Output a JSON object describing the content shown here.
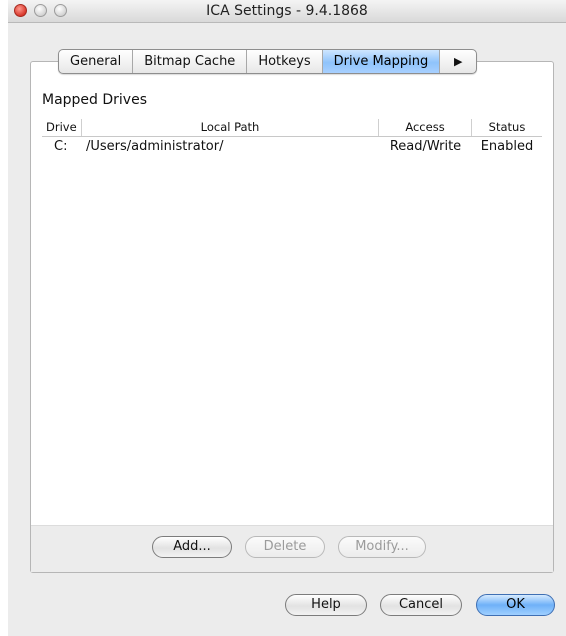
{
  "window": {
    "title": "ICA Settings - 9.4.1868"
  },
  "tabs": [
    {
      "label": "General",
      "selected": false
    },
    {
      "label": "Bitmap Cache",
      "selected": false
    },
    {
      "label": "Hotkeys",
      "selected": false
    },
    {
      "label": "Drive Mapping",
      "selected": true
    },
    {
      "label": "more-tabs-arrow-icon",
      "selected": false
    }
  ],
  "mapped_drives": {
    "section_label": "Mapped Drives",
    "columns": [
      "Drive",
      "Local Path",
      "Access",
      "Status"
    ],
    "rows": [
      {
        "drive": "C:",
        "local_path": "/Users/administrator/",
        "access": "Read/Write",
        "status": "Enabled"
      }
    ]
  },
  "panel_buttons": {
    "add": {
      "label": "Add...",
      "enabled": true
    },
    "delete": {
      "label": "Delete",
      "enabled": false
    },
    "modify": {
      "label": "Modify...",
      "enabled": false
    }
  },
  "dialog_buttons": {
    "help": "Help",
    "cancel": "Cancel",
    "ok": "OK"
  },
  "colors": {
    "active_tab": "#8fc3fb",
    "default_button": "#6fb1f8",
    "close_button": "#d8382c"
  }
}
